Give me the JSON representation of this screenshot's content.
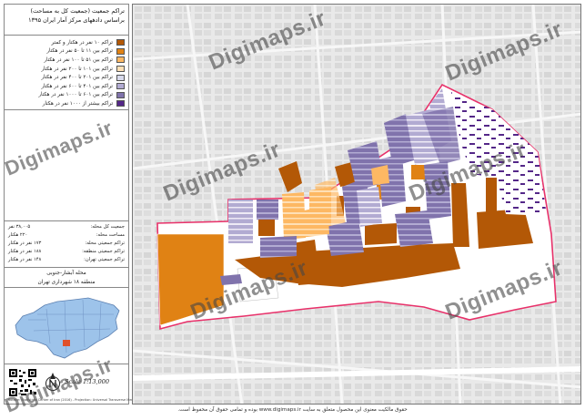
{
  "title": {
    "line1": "تراکم جمعیت (جمعیت کل به مساحت)",
    "line2": "براساس دادههای مرکز آمار ایران ۱۳۹۵"
  },
  "legend": [
    {
      "label": "تراکم ۱۰ نفر در هکتار و کمتر",
      "color": "#b35806"
    },
    {
      "label": "تراکم بین ۱۱ تا ۵۰ نفر در هکتار",
      "color": "#e08214"
    },
    {
      "label": "تراکم بین ۵۱ تا ۱۰۰ نفر در هکتار",
      "color": "#fdb863"
    },
    {
      "label": "تراکم بین ۱۰۱ تا ۲۰۰ نفر در هکتار",
      "color": "#fee0b6"
    },
    {
      "label": "تراکم بین ۲۰۱ تا ۴۰۰ نفر در هکتار",
      "color": "#d8daeb"
    },
    {
      "label": "تراکم بین ۴۰۱ تا ۶۰۰ نفر در هکتار",
      "color": "#b2abd2"
    },
    {
      "label": "تراکم بین ۶۰۱ تا ۱۰۰۰ نفر در هکتار",
      "color": "#8073ac"
    },
    {
      "label": "تراکم بیشتر از ۱۰۰۰ نفر در هکتار",
      "color": "#542788"
    }
  ],
  "stats": [
    {
      "label": "جمعیت کل محله:",
      "value": "۳۸,۰۰۵ نفر"
    },
    {
      "label": "مساحت محله:",
      "value": "۲۲۰ هکتار"
    },
    {
      "label": "تراکم جمعیتی محله:",
      "value": "۱۷۳ نفر در هکتار"
    },
    {
      "label": "تراکم جمعیتی منطقه:",
      "value": "۱۸۸ نفر در هکتار"
    },
    {
      "label": "تراکم جمعیتی تهران:",
      "value": "۱۴۸ نفر در هکتار"
    }
  ],
  "region": {
    "line1": "محله آبشار-جنوبی",
    "line2": "منطقه ۱۸ شهرداری تهران"
  },
  "scale": "Scale 1:13,000",
  "credit": "Source: Statistical Center of Iran (2016) - Projection: Universal Transverse Mercator",
  "watermark": "Digimaps.ir",
  "footer": "حقوق مالکیت معنوی این محصول متعلق به سایت www.digimaps.ir بوده و تمامی حقوق آن محفوظ است.",
  "colors": {
    "boundary": "#e8316a",
    "inset_fill": "#9dc3ea",
    "highlight": "#e0502a"
  }
}
